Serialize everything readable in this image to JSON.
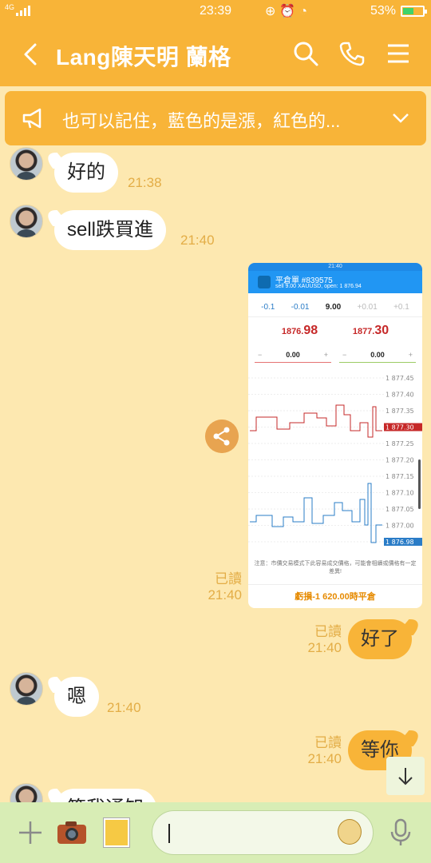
{
  "status_bar": {
    "network": "4G",
    "time": "23:39",
    "icons": [
      "lock-rotation-icon",
      "alarm-icon",
      "wifi-icon"
    ],
    "battery_percent": "53%",
    "battery_level": 0.53
  },
  "header": {
    "title": "Lang陳天明  蘭格",
    "icons": [
      "back-icon",
      "search-icon",
      "phone-icon",
      "menu-icon"
    ],
    "color": "#f8b438"
  },
  "announcement": {
    "text": "也可以記住，藍色的是漲，紅色的..."
  },
  "messages": [
    {
      "side": "in",
      "text": "好的",
      "time": "21:38"
    },
    {
      "side": "in",
      "text": "sell跌買進",
      "time": "21:40"
    },
    {
      "side": "out",
      "type": "image",
      "read": "已讀",
      "time": "21:40"
    },
    {
      "side": "out",
      "text": "好了",
      "read": "已讀",
      "time": "21:40"
    },
    {
      "side": "in",
      "text": "嗯",
      "time": "21:40"
    },
    {
      "side": "out",
      "text": "等你",
      "read": "已讀",
      "time": "21:40"
    },
    {
      "side": "in",
      "text": "等我通知"
    }
  ],
  "screenshot": {
    "status_time": "21:40",
    "title": "平倉單 #839575",
    "subtitle": "sell 9.00 XAUUSD, open: 1 876.94",
    "steps": [
      "-0.1",
      "-0.01",
      "9.00",
      "+0.01",
      "+0.1"
    ],
    "bid_prefix": "1876.",
    "bid_big": "98",
    "ask_prefix": "1877.",
    "ask_big": "30",
    "sl_value": "0.00",
    "tp_value": "0.00",
    "price_ticks": [
      "1 877.45",
      "1 877.40",
      "1 877.35",
      "1 877.30",
      "1 877.25",
      "1 877.20",
      "1 877.15",
      "1 877.10",
      "1 877.05",
      "1 877.00",
      "1 876.98"
    ],
    "note": "注意：市價交易模式下此容易成交價格，可能會相續或價格有一定差異!",
    "footer": "虧損-1 620.00時平倉"
  },
  "input_bar": {
    "icons": [
      "plus-icon",
      "camera-icon",
      "sticker-icon",
      "emoji-icon",
      "mic-icon"
    ]
  }
}
